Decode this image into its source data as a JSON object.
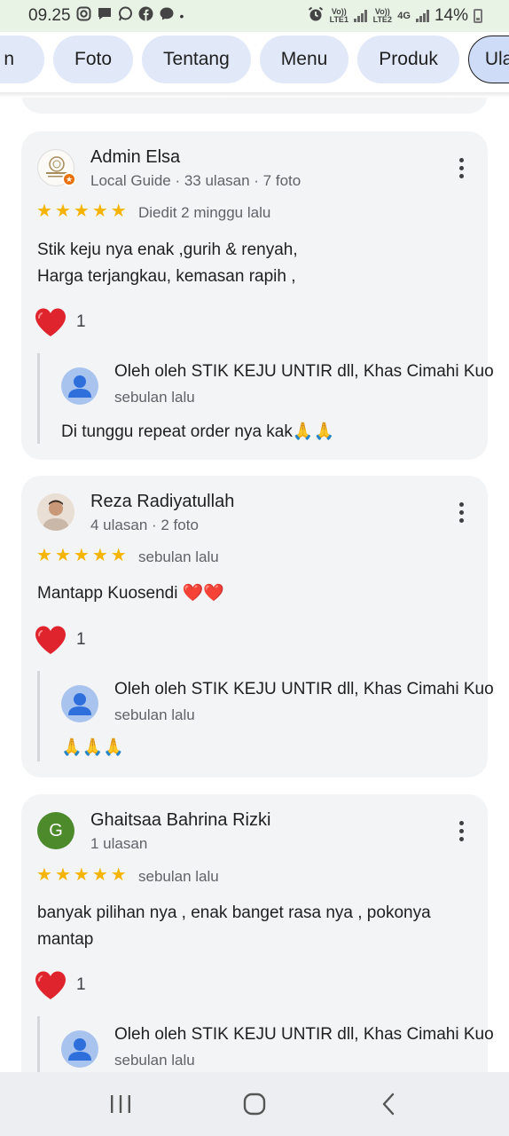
{
  "status_bar": {
    "time": "09.25",
    "dot": "•",
    "battery": "14%",
    "lte1": "Vo)) LTE1",
    "lte2": "Vo)) LTE2",
    "net": "4G"
  },
  "tabs": [
    {
      "label": "n"
    },
    {
      "label": "Foto"
    },
    {
      "label": "Tentang"
    },
    {
      "label": "Menu"
    },
    {
      "label": "Produk"
    },
    {
      "label": "Ulasan",
      "active": true
    }
  ],
  "reviews": [
    {
      "author": "Admin Elsa",
      "meta": "Local Guide · 33 ulasan · 7 foto",
      "rating": 5,
      "time": "Diedit 2 minggu lalu",
      "text_line1": "Stik keju nya enak ,gurih & renyah,",
      "text_line2": "Harga terjangkau, kemasan rapih ,",
      "likes": "1",
      "reply": {
        "owner": "Oleh oleh STIK KEJU UNTIR dll, Khas Cimahi Kuo",
        "time": "sebulan lalu",
        "text": "Di tunggu repeat order nya kak🙏🙏"
      }
    },
    {
      "author": "Reza Radiyatullah",
      "meta": "4 ulasan · 2 foto",
      "rating": 5,
      "time": "sebulan lalu",
      "text_line1": "Mantapp Kuosendi ❤️❤️",
      "likes": "1",
      "reply": {
        "owner": "Oleh oleh STIK KEJU UNTIR dll, Khas Cimahi Kuo",
        "time": "sebulan lalu",
        "text": "🙏🙏🙏"
      }
    },
    {
      "author": "Ghaitsaa Bahrina Rizki",
      "avatar_letter": "G",
      "meta": "1 ulasan",
      "rating": 5,
      "time": "sebulan lalu",
      "text_line1": "banyak pilihan nya , enak banget rasa nya , pokonya",
      "text_line2": "mantap",
      "likes": "1",
      "reply": {
        "owner": "Oleh oleh STIK KEJU UNTIR dll, Khas Cimahi Kuo",
        "time": "sebulan lalu"
      }
    }
  ],
  "colors": {
    "star": "#f4b400",
    "heart": "#e0242e",
    "card_bg": "#f3f4f6",
    "chip_bg": "#e1e9f9",
    "status_bg": "#e8f3e6"
  },
  "icons": [
    "more-vert-icon",
    "heart-icon",
    "star-icon",
    "person-icon",
    "recent-apps-icon",
    "home-icon",
    "back-icon"
  ]
}
